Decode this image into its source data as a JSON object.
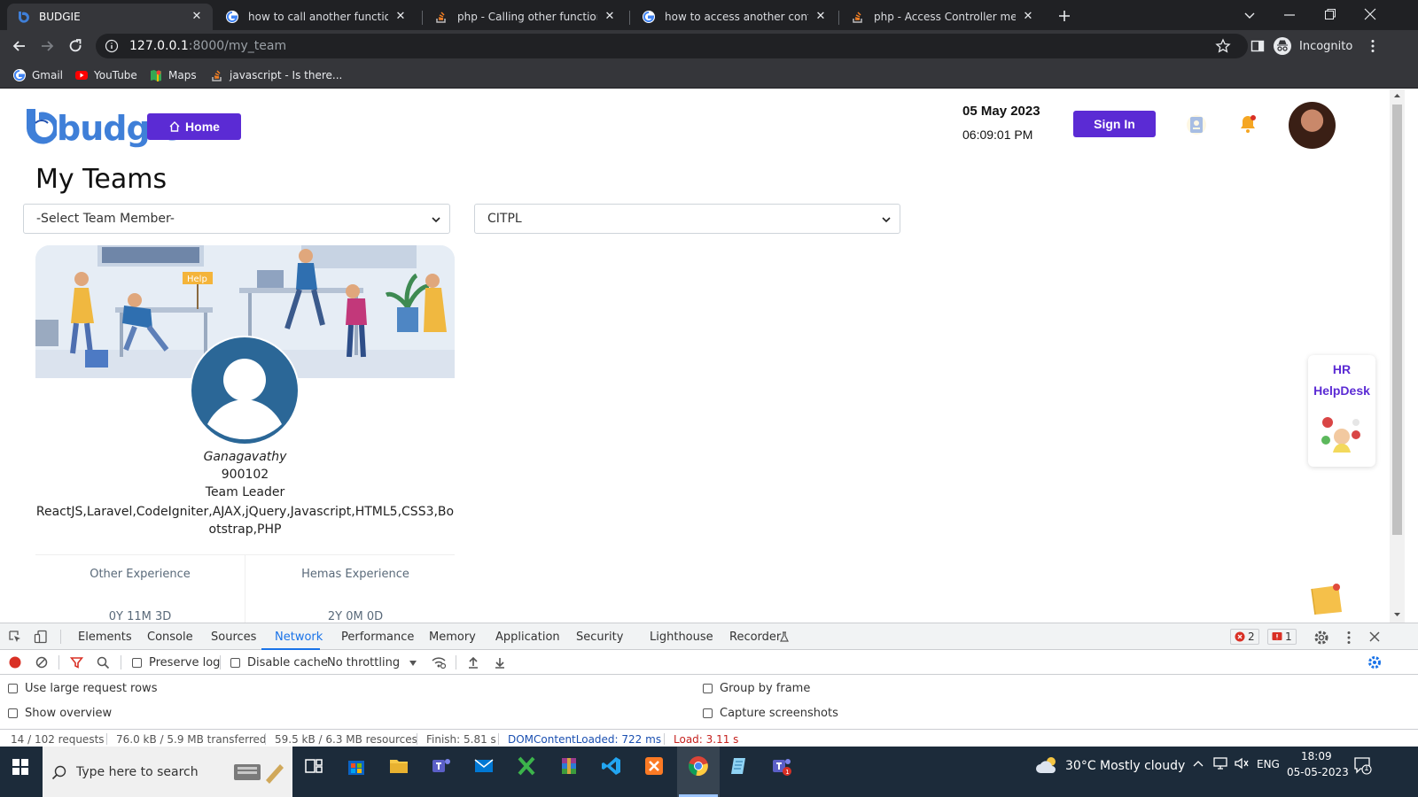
{
  "browser": {
    "tabs": [
      {
        "title": "BUDGIE",
        "active": true
      },
      {
        "title": "how to call another function in fu"
      },
      {
        "title": "php - Calling other function in th"
      },
      {
        "title": "how to access another controller"
      },
      {
        "title": "php - Access Controller method i"
      }
    ],
    "url_host": "127.0.0.1",
    "url_path": ":8000/my_team",
    "profile_label": "Incognito",
    "bookmarks": [
      "Gmail",
      "YouTube",
      "Maps",
      "javascript - Is there..."
    ]
  },
  "header": {
    "logo_text": "budgie",
    "home_label": "Home",
    "date": "05 May 2023",
    "time": "06:09:01 PM",
    "signin_label": "Sign In"
  },
  "main": {
    "title": "My Teams",
    "member_select": "-Select Team Member-",
    "company_select": "CITPL"
  },
  "card": {
    "banner_sign": "Help",
    "name": "Ganagavathy",
    "emp_id": "900102",
    "role": "Team Leader",
    "skills": "ReactJS,Laravel,CodeIgniter,AJAX,jQuery,Javascript,HTML5,CSS3,Bootstrap,PHP",
    "other_exp_label": "Other Experience",
    "other_exp_value": "0Y 11M 3D",
    "hemas_exp_label": "Hemas Experience",
    "hemas_exp_value": "2Y 0M 0D"
  },
  "hr_widget": {
    "line1": "HR",
    "line2": "HelpDesk"
  },
  "devtools": {
    "tabs": [
      "Elements",
      "Console",
      "Sources",
      "Network",
      "Performance",
      "Memory",
      "Application",
      "Security",
      "Lighthouse",
      "Recorder"
    ],
    "active_tab": "Network",
    "error_count": "2",
    "issue_count": "1",
    "preserve_log": "Preserve log",
    "disable_cache": "Disable cache",
    "throttling": "No throttling",
    "use_large_rows": "Use large request rows",
    "show_overview": "Show overview",
    "group_by_frame": "Group by frame",
    "capture_screenshots": "Capture screenshots",
    "status": {
      "requests": "14 / 102 requests",
      "transferred": "76.0 kB / 5.9 MB transferred",
      "resources": "59.5 kB / 6.3 MB resources",
      "finish": "Finish: 5.81 s",
      "dcl": "DOMContentLoaded: 722 ms",
      "load": "Load: 3.11 s"
    }
  },
  "taskbar": {
    "search_placeholder": "Type here to search",
    "weather": "30°C  Mostly cloudy",
    "lang": "ENG",
    "clock_time": "18:09",
    "clock_date": "05-05-2023",
    "notif_count": "1"
  },
  "colors": {
    "accent": "#5b2bd4",
    "logo": "#3f7fd8",
    "devtools_blue": "#1a73e8",
    "error_red": "#d93025"
  }
}
